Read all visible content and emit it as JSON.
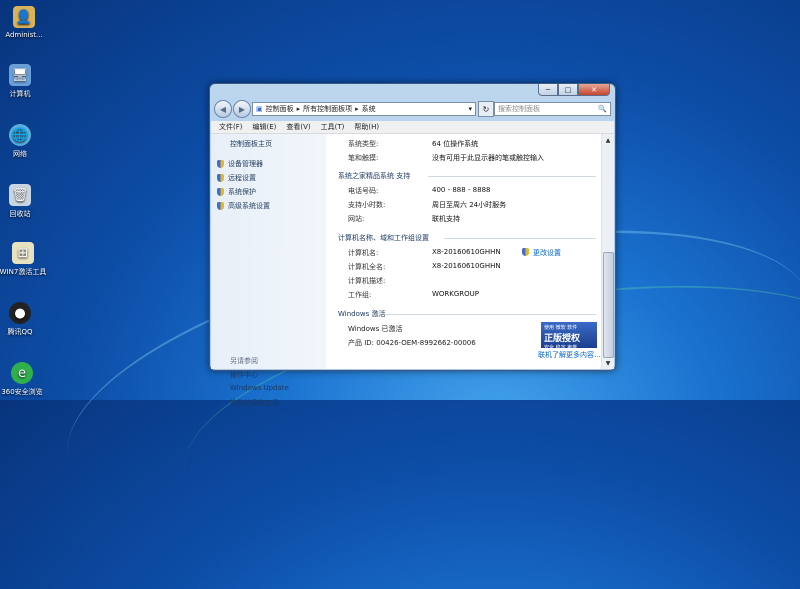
{
  "desktop_icons": [
    {
      "label": "Administ...",
      "icon": "user-folder-icon",
      "color": "#d9b35a"
    },
    {
      "label": "计算机",
      "icon": "computer-icon",
      "color": "#6aa0d8"
    },
    {
      "label": "网络",
      "icon": "network-globe-icon",
      "color": "#5bb0e0"
    },
    {
      "label": "回收站",
      "icon": "recycle-bin-icon",
      "color": "#c9d5e2"
    },
    {
      "label": "WIN7激活工具",
      "icon": "activation-tool-icon",
      "color": "#e7e2c0"
    },
    {
      "label": "腾讯QQ",
      "icon": "qq-penguin-icon",
      "color": "#222222"
    },
    {
      "label": "360安全浏览",
      "icon": "360-browser-icon",
      "color": "#2fb04a"
    }
  ],
  "window": {
    "title_buttons": {
      "minimize": "─",
      "maximize": "□",
      "close": "✕"
    },
    "nav": {
      "back": "◀",
      "forward": "▶"
    },
    "address": {
      "icon": "▣",
      "parts": [
        "控制面板",
        "所有控制面板项",
        "系统"
      ],
      "sep": "▸",
      "dropdown": "▾"
    },
    "refresh": "↻",
    "search": {
      "placeholder": "搜索控制面板",
      "icon": "🔍"
    },
    "menu": [
      "文件(F)",
      "编辑(E)",
      "查看(V)",
      "工具(T)",
      "帮助(H)"
    ],
    "left": {
      "home": "控制面板主页",
      "items": [
        "设备管理器",
        "远程设置",
        "系统保护",
        "高级系统设置"
      ],
      "see_also": "另请参阅",
      "links": [
        "操作中心",
        "Windows Update",
        "性能信息和工具"
      ]
    },
    "system": {
      "type_label": "系统类型:",
      "type_value": "64 位操作系统",
      "pen_label": "笔和触摸:",
      "pen_value": "没有可用于此显示器的笔或触控输入"
    },
    "support": {
      "header": "系统之家精品系统 支持",
      "rows": [
        {
          "label": "电话号码:",
          "value": "400 - 888 - 8888"
        },
        {
          "label": "支持小时数:",
          "value": "周日至周六  24小时服务"
        },
        {
          "label": "网站:",
          "value": "联机支持"
        }
      ]
    },
    "computer": {
      "header": "计算机名称、域和工作组设置",
      "rows": [
        {
          "label": "计算机名:",
          "value": "X8-20160610GHHN"
        },
        {
          "label": "计算机全名:",
          "value": "X8-20160610GHHN"
        },
        {
          "label": "计算机描述:",
          "value": ""
        },
        {
          "label": "工作组:",
          "value": "WORKGROUP"
        }
      ],
      "change": "更改设置"
    },
    "activation": {
      "header": "Windows 激活",
      "status": "Windows 已激活",
      "product_id": "产品 ID: 00426-OEM-8992662-00006",
      "badge_small": "使用 微软 软件",
      "badge_big": "正版授权",
      "badge_sub": "安全 稳定 声誉",
      "more": "联机了解更多内容..."
    },
    "scroll": {
      "up": "▲",
      "down": "▼"
    }
  }
}
